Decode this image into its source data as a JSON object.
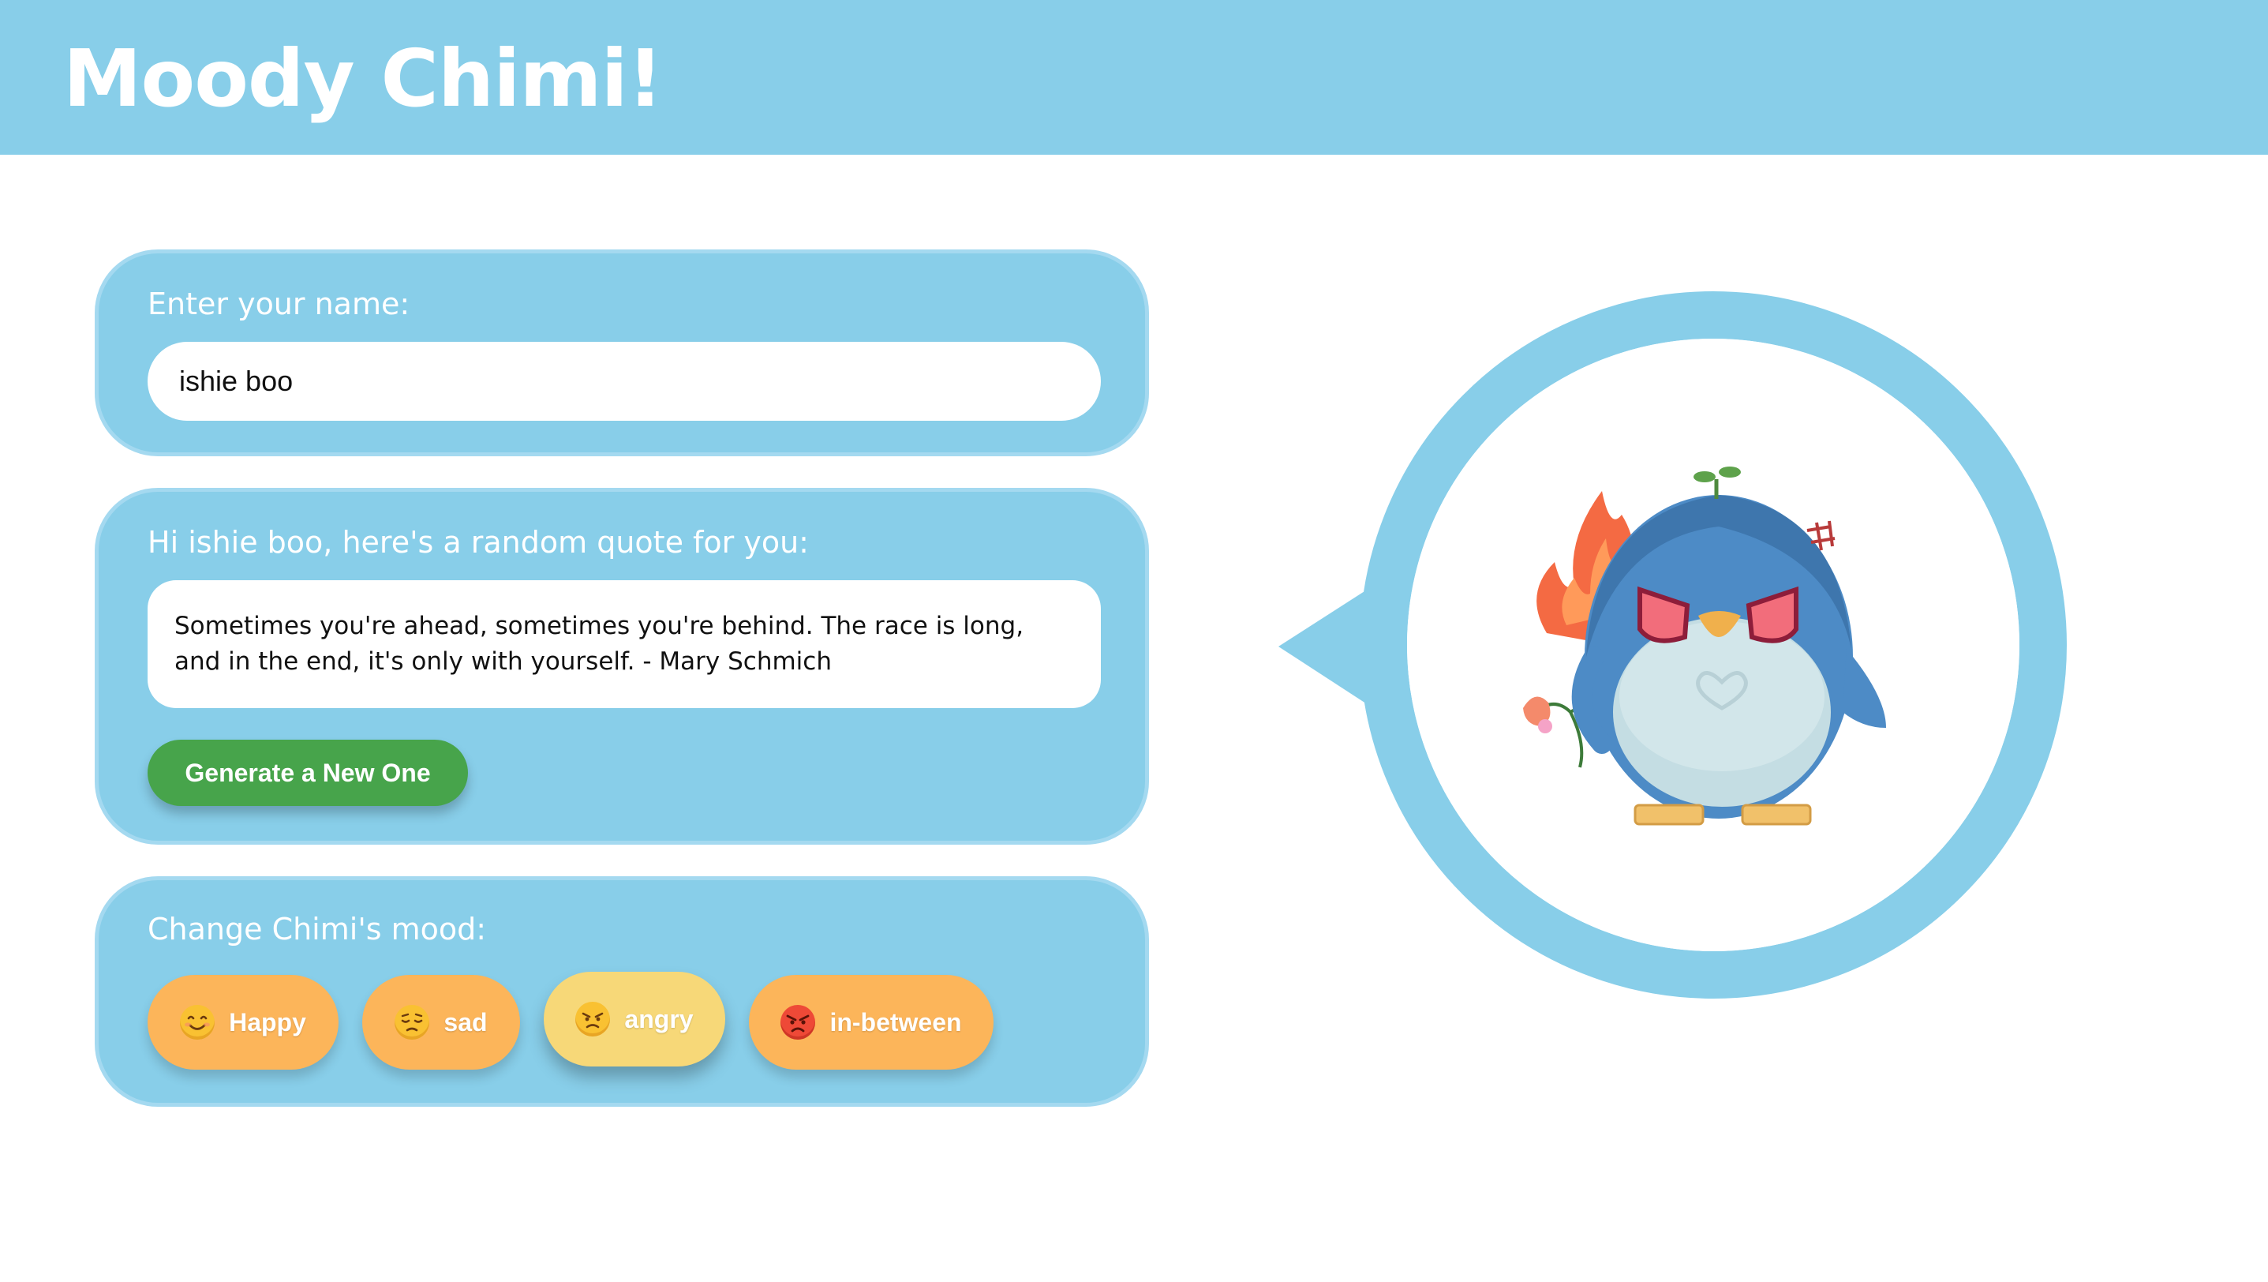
{
  "app": {
    "title": "Moody Chimi!"
  },
  "name_card": {
    "label": "Enter your name:",
    "value": "ishie boo",
    "placeholder": ""
  },
  "quote_card": {
    "greeting": "Hi ishie boo, here's a random quote for you:",
    "quote": "Sometimes you're ahead, sometimes you're behind. The race is long, and in the end, it's only with yourself. - Mary Schmich",
    "generate_label": "Generate a New One"
  },
  "mood_card": {
    "label": "Change Chimi's mood:",
    "buttons": [
      {
        "label": "Happy",
        "icon": "smiling-face-icon"
      },
      {
        "label": "sad",
        "icon": "pensive-face-icon"
      },
      {
        "label": "angry",
        "icon": "unamused-face-icon",
        "active": true
      },
      {
        "label": "in-between",
        "icon": "pouting-face-icon"
      }
    ]
  },
  "mascot": {
    "current_mood": "angry",
    "icon": "angry-penguin-icon"
  },
  "colors": {
    "header": "#88cee9",
    "card": "#88cee9",
    "generate_button": "#47a44b",
    "mood_button": "#fcb55a",
    "mood_button_active": "#f7d878",
    "bubble_ring": "#88cee9"
  }
}
